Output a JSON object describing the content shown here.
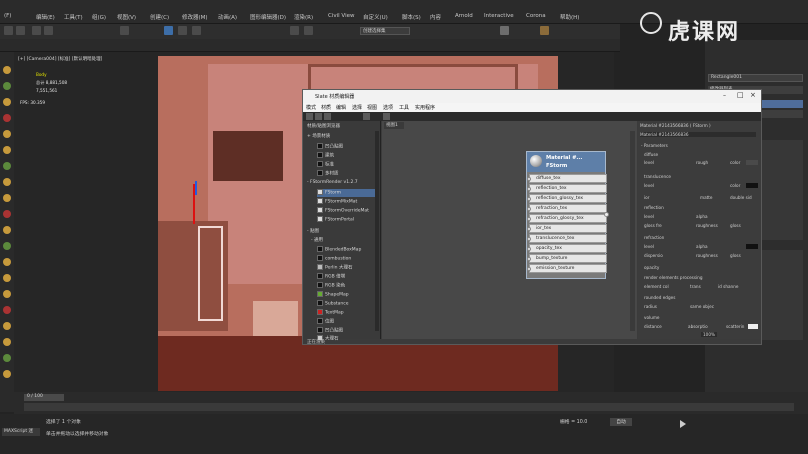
{
  "menubar": {
    "items": [
      "(F)",
      "编辑(E)",
      "工具(T)",
      "组(G)",
      "视图(V)",
      "创建(C)",
      "修改器(M)",
      "动画(A)",
      "图形编辑器(D)",
      "渲染(R)",
      "Civil View",
      "自定义(U)",
      "脚本(S)",
      "内容",
      "Arnold",
      "Interactive",
      "Corona",
      "帮助(H)"
    ]
  },
  "toolbar": {
    "selection_set": "创建选择集"
  },
  "viewport": {
    "label": "[+] [Camera004] [标准] [默认明暗处理]",
    "stats": [
      "Body",
      "总计 8,881,508",
      "7,551,561",
      "FPS: 30.359"
    ]
  },
  "slate": {
    "title": "Slate 材质编辑器",
    "menu": [
      "模式",
      "材质",
      "编辑",
      "选择",
      "视图",
      "选项",
      "工具",
      "实用程序"
    ],
    "view_tab": "视图1",
    "browser": {
      "header": "材质/贴图浏览器",
      "section_open": "+ 场景材质",
      "scene_items": [
        "凹凸贴图",
        "建筑",
        "标准",
        "多材质"
      ],
      "fstorm_header": "- FStormRender v1.2.7",
      "fstorm_items": [
        "FStorm",
        "FStormMixMat",
        "FStormOverrideMat",
        "FStormPortal"
      ],
      "maps_header": "- 贴图",
      "general_header": "- 通用",
      "map_items": [
        "BlendedBoxMap",
        "combustion",
        "Perlin 大理石",
        "RGB 倍增",
        "RGB 染色",
        "ShapeMap",
        "Substance",
        "TextMap",
        "位图",
        "凹凸贴图",
        "大理石"
      ],
      "bottom_label": "正在渲染"
    },
    "node": {
      "title_line1": "Material #...",
      "title_line2": "FStorm",
      "slots": [
        "diffuse_tex",
        "reflection_tex",
        "reflection_glossy_tex",
        "refraction_tex",
        "refraction_glossy_tex",
        "ior_tex",
        "translucence_tex",
        "opacity_tex",
        "bump_texture",
        "emission_texture"
      ]
    },
    "props": {
      "header1": "Material #2143566836 ( FStorm )",
      "header2": "Material #2143566836",
      "section": "- Parameters",
      "rows": [
        "diffuse",
        "level",
        "translucence",
        "level",
        "ior",
        "reflection",
        "level",
        "gloss fre",
        "refraction",
        "level",
        "dispersio",
        "opacity",
        "render elements processing",
        "element col",
        "rounded edges",
        "radius",
        "volume",
        "distance"
      ],
      "labels": [
        "rough",
        "color",
        "color",
        "matte",
        "double sid",
        "alpha",
        "roughness",
        "gloss",
        "alpha",
        "roughness",
        "gloss",
        "trans",
        "id shanne",
        "same objec",
        "absorptio",
        "scatterin"
      ],
      "zoom": "100%"
    }
  },
  "status": {
    "selected": "选择了 1 个对象",
    "hint": "单击并拖动以选择并移动对象",
    "script": "MAXScript 迷",
    "frame": "0 / 100",
    "auto_key": "自动",
    "grid": "栅格 = 10.0"
  },
  "rightpanel": {
    "name": "Rectangle001",
    "items": [
      "修改器列表",
      "Edit Poly",
      "Rectangle"
    ]
  },
  "watermark": "虎课网"
}
